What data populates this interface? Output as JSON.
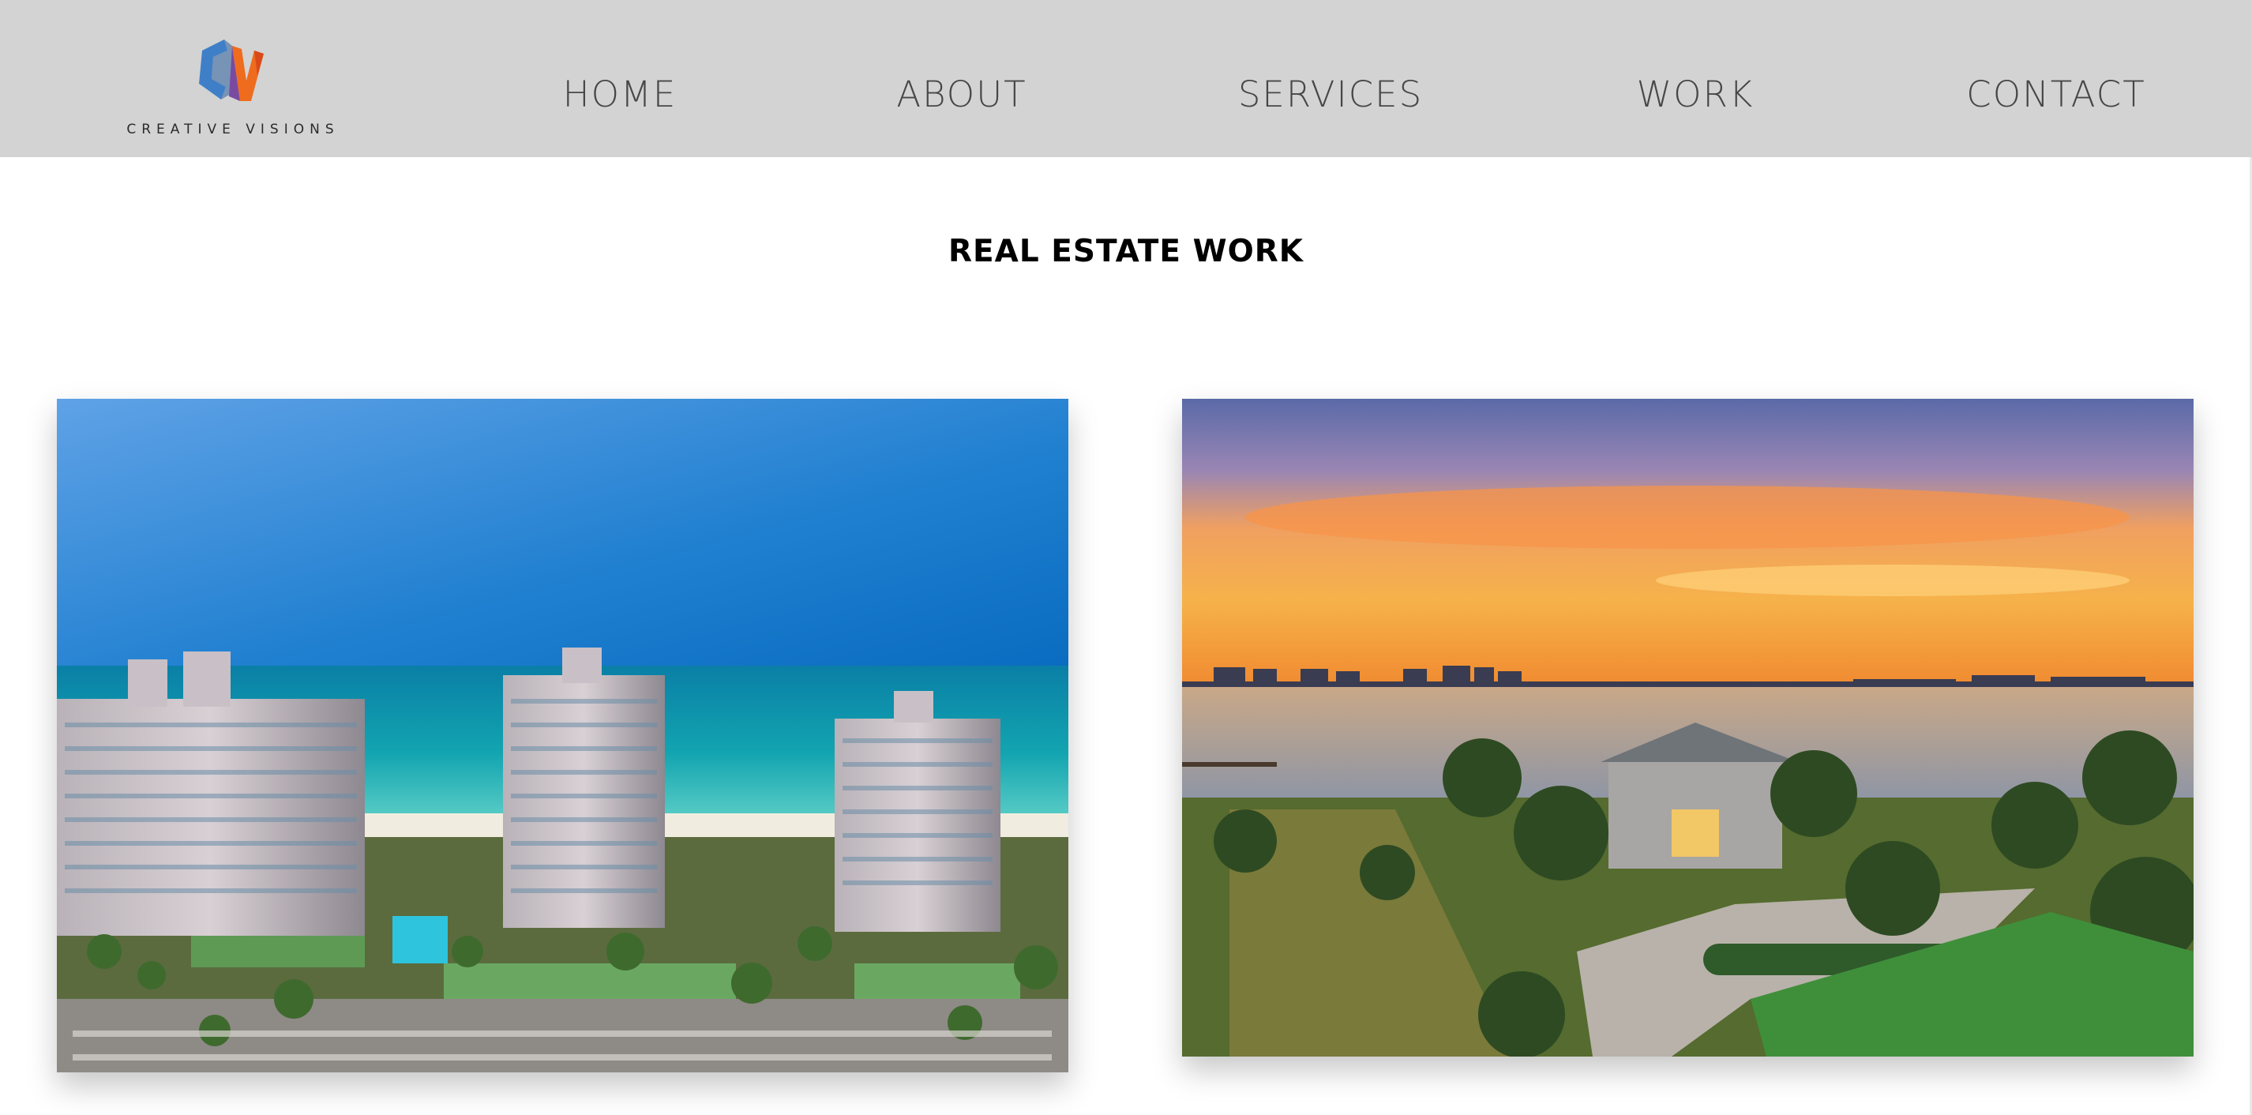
{
  "brand": {
    "name": "CREATIVE VISIONS",
    "logo_icon": "cv-logo-icon",
    "colors": {
      "blue": "#3f7fc8",
      "orange": "#ef6c1e",
      "purple": "#7a4aa0"
    }
  },
  "nav": {
    "items": [
      {
        "label": "HOME"
      },
      {
        "label": "ABOUT"
      },
      {
        "label": "SERVICES"
      },
      {
        "label": "WORK"
      },
      {
        "label": "CONTACT"
      }
    ]
  },
  "section": {
    "title": "REAL ESTATE WORK"
  },
  "gallery": {
    "photos": [
      {
        "subject": "aerial-beachfront-condo-towers"
      },
      {
        "subject": "waterfront-estate-at-sunset"
      }
    ]
  },
  "theme": {
    "header_bg": "#d3d3d3",
    "page_bg": "#ffffff",
    "nav_text": "#3c3c3c",
    "title_text": "#000000"
  }
}
